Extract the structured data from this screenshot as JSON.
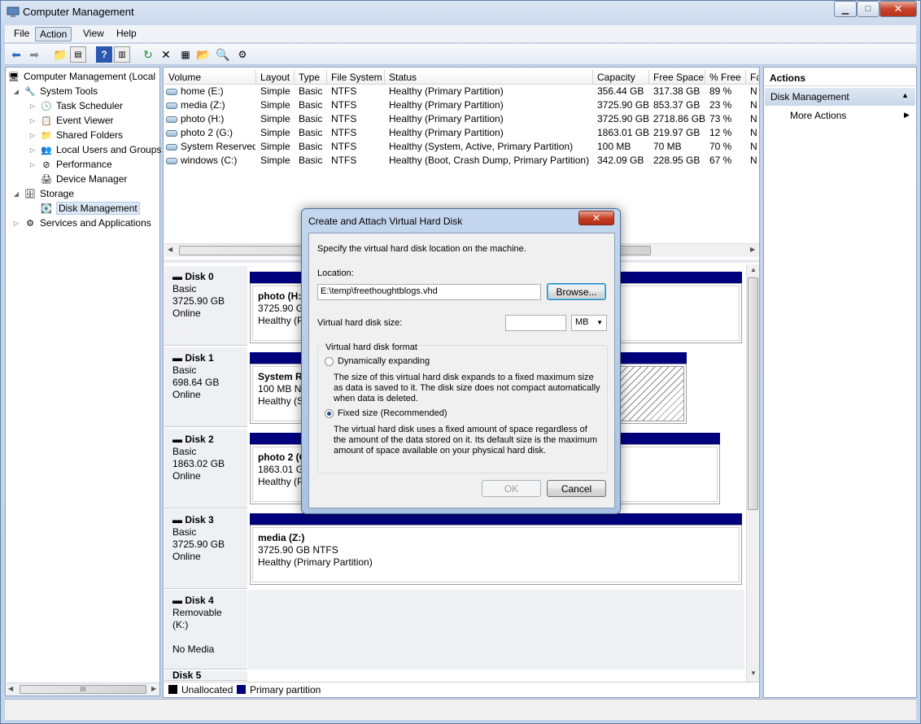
{
  "window": {
    "title": "Computer Management",
    "minimize": "▁",
    "maximize": "□",
    "close": "✕"
  },
  "menu": [
    "File",
    "Action",
    "View",
    "Help"
  ],
  "toolbar_icons": [
    "back-icon",
    "forward-icon",
    "up-folder-icon",
    "show-hide-console-tree-icon",
    "help-icon",
    "show-hide-action-pane-icon",
    "refresh-icon",
    "delete-icon",
    "properties-icon",
    "open-folder-icon",
    "search-disk-icon",
    "settings-icon"
  ],
  "tree": {
    "root": "Computer Management (Local",
    "system_tools": "System Tools",
    "task_scheduler": "Task Scheduler",
    "event_viewer": "Event Viewer",
    "shared_folders": "Shared Folders",
    "local_users": "Local Users and Groups",
    "performance": "Performance",
    "device_manager": "Device Manager",
    "storage": "Storage",
    "disk_management": "Disk Management",
    "services": "Services and Applications",
    "scroll_grip": "III"
  },
  "volumes": {
    "columns": [
      "Volume",
      "Layout",
      "Type",
      "File System",
      "Status",
      "Capacity",
      "Free Space",
      "% Free",
      "Fa"
    ],
    "rows": [
      [
        "home (E:)",
        "Simple",
        "Basic",
        "NTFS",
        "Healthy (Primary Partition)",
        "356.44 GB",
        "317.38 GB",
        "89 %",
        "N"
      ],
      [
        "media (Z:)",
        "Simple",
        "Basic",
        "NTFS",
        "Healthy (Primary Partition)",
        "3725.90 GB",
        "853.37 GB",
        "23 %",
        "N"
      ],
      [
        "photo (H:)",
        "Simple",
        "Basic",
        "NTFS",
        "Healthy (Primary Partition)",
        "3725.90 GB",
        "2718.86 GB",
        "73 %",
        "N"
      ],
      [
        "photo 2 (G:)",
        "Simple",
        "Basic",
        "NTFS",
        "Healthy (Primary Partition)",
        "1863.01 GB",
        "219.97 GB",
        "12 %",
        "N"
      ],
      [
        "System Reserved",
        "Simple",
        "Basic",
        "NTFS",
        "Healthy (System, Active, Primary Partition)",
        "100 MB",
        "70 MB",
        "70 %",
        "N"
      ],
      [
        "windows (C:)",
        "Simple",
        "Basic",
        "NTFS",
        "Healthy (Boot, Crash Dump, Primary Partition)",
        "342.09 GB",
        "228.95 GB",
        "67 %",
        "N"
      ]
    ]
  },
  "disks": [
    {
      "name": "Disk 0",
      "type": "Basic",
      "size": "3725.90 GB",
      "state": "Online",
      "part_title": "photo  (H:",
      "part_size": "3725.90 GB",
      "part_status": "Healthy (P"
    },
    {
      "name": "Disk 1",
      "type": "Basic",
      "size": "698.64 GB",
      "state": "Online",
      "part_title": "System Re",
      "part_size": "100 MB NTF",
      "part_status": "Healthy (Sy"
    },
    {
      "name": "Disk 2",
      "type": "Basic",
      "size": "1863.02 GB",
      "state": "Online",
      "part_title": "photo 2  (G",
      "part_size": "1863.01 GB",
      "part_status": "Healthy (P"
    },
    {
      "name": "Disk 3",
      "type": "Basic",
      "size": "3725.90 GB",
      "state": "Online",
      "part_title": "media  (Z:)",
      "part_size": "3725.90 GB NTFS",
      "part_status": "Healthy (Primary Partition)"
    },
    {
      "name": "Disk 4",
      "type": "Removable (K:)",
      "state": "No Media"
    },
    {
      "name": "Disk 5"
    }
  ],
  "legend": {
    "unallocated": "Unallocated",
    "primary": "Primary partition"
  },
  "actions": {
    "header": "Actions",
    "section": "Disk Management",
    "more": "More Actions"
  },
  "dialog": {
    "title": "Create and Attach Virtual Hard Disk",
    "close": "✕",
    "intro": "Specify the virtual hard disk location on the machine.",
    "location_label": "Location:",
    "location_value": "E:\\temp\\freethoughtblogs.vhd",
    "browse": "Browse...",
    "size_label": "Virtual hard disk size:",
    "size_value": "",
    "unit": "MB",
    "format_label": "Virtual hard disk format",
    "dynamic_label": "Dynamically expanding",
    "dynamic_desc": "The size of this virtual hard disk expands to a fixed maximum size as data is saved to it.  The disk size does not compact automatically when data is deleted.",
    "fixed_label": "Fixed size (Recommended)",
    "fixed_desc": "The virtual hard disk uses a fixed amount of space regardless of the amount of the data stored on it.  Its default size is the maximum amount of space available on your physical hard disk.",
    "ok": "OK",
    "cancel": "Cancel"
  }
}
